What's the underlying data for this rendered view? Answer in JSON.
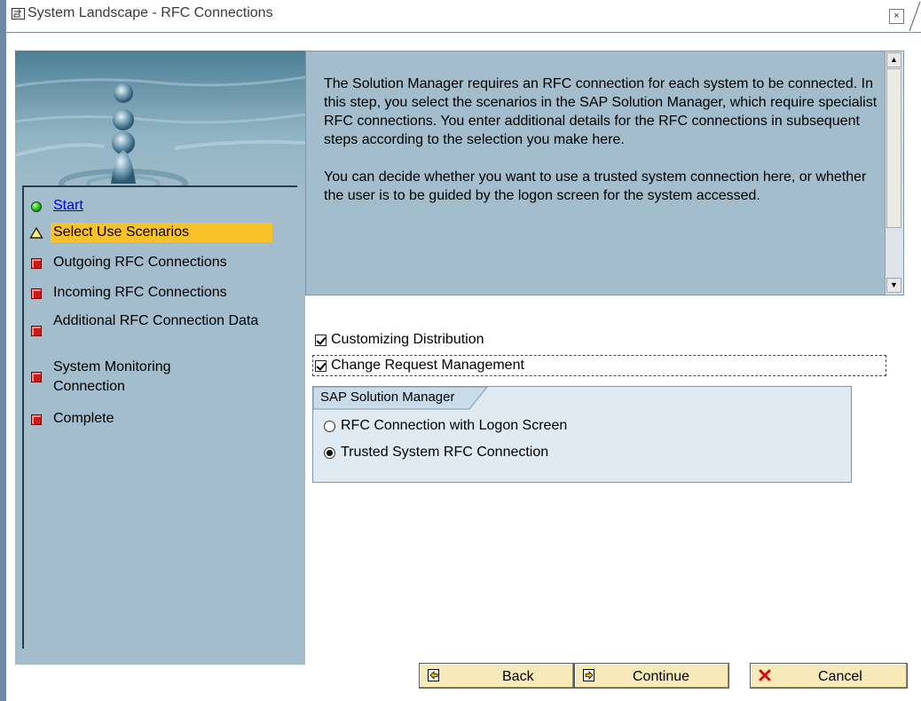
{
  "window": {
    "title": "System Landscape - RFC Connections",
    "close_label": "×"
  },
  "sidebar": {
    "items": [
      {
        "label": "Start",
        "icon": "green-circle-icon",
        "state": "link"
      },
      {
        "label": "Select Use Scenarios",
        "icon": "yellow-triangle-icon",
        "state": "active"
      },
      {
        "label": "Outgoing RFC Connections",
        "icon": "red-square-icon",
        "state": "pending"
      },
      {
        "label": "Incoming RFC Connections",
        "icon": "red-square-icon",
        "state": "pending"
      },
      {
        "label": "Additional RFC Connection Data",
        "icon": "red-square-icon",
        "state": "pending"
      },
      {
        "label": "System Monitoring Connection",
        "icon": "red-square-icon",
        "state": "pending"
      },
      {
        "label": "Complete",
        "icon": "red-square-icon",
        "state": "pending"
      }
    ]
  },
  "description": {
    "text": "The Solution Manager requires an RFC connection for each system to be connected. In this step, you select the scenarios in the SAP Solution Manager, which require specialist RFC connections. You enter additional details for the RFC connections in subsequent steps according to the selection you make here.\n\nYou can decide whether you want to use a trusted system connection here, or whether the user is to be guided by the logon screen for the system accessed."
  },
  "options": {
    "customizing_distribution": {
      "label": "Customizing Distribution",
      "checked": true
    },
    "change_request_management": {
      "label": "Change Request Management",
      "checked": true
    }
  },
  "group": {
    "title": "SAP Solution Manager",
    "radios": [
      {
        "label": "RFC Connection with Logon Screen",
        "selected": false
      },
      {
        "label": "Trusted System RFC Connection",
        "selected": true
      }
    ]
  },
  "buttons": {
    "back": "Back",
    "continue": "Continue",
    "cancel": "Cancel"
  },
  "colors": {
    "panel": "#a3bdcc",
    "active_highlight": "#f9c12a",
    "button_face": "#f8e9b8"
  }
}
